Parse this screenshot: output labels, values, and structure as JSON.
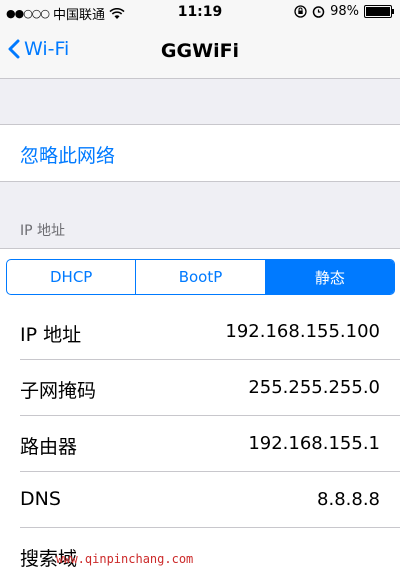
{
  "status_bar": {
    "signal_dots": "●●○○○",
    "carrier": "中国联通",
    "time": "11:19",
    "battery": "98%",
    "battery_level": 0.98,
    "icons": [
      "wifi-icon",
      "rotation-lock-icon",
      "alarm-icon",
      "battery-icon"
    ]
  },
  "nav": {
    "back_label": "Wi-Fi",
    "title": "GGWiFi"
  },
  "forget_network": "忽略此网络",
  "ip_section": {
    "header": "IP 地址",
    "segments": [
      "DHCP",
      "BootP",
      "静态"
    ],
    "selected_segment": "静态",
    "rows": [
      {
        "label": "IP 地址",
        "value": "192.168.155.100"
      },
      {
        "label": "子网掩码",
        "value": "255.255.255.0"
      },
      {
        "label": "路由器",
        "value": "192.168.155.1"
      },
      {
        "label": "DNS",
        "value": "8.8.8.8"
      },
      {
        "label": "搜索域",
        "value": ""
      }
    ]
  },
  "watermark": "www.qinpinchang.com",
  "colors": {
    "accent": "#007aff",
    "background": "#efeff4",
    "watermark": "#cc2a2a"
  }
}
